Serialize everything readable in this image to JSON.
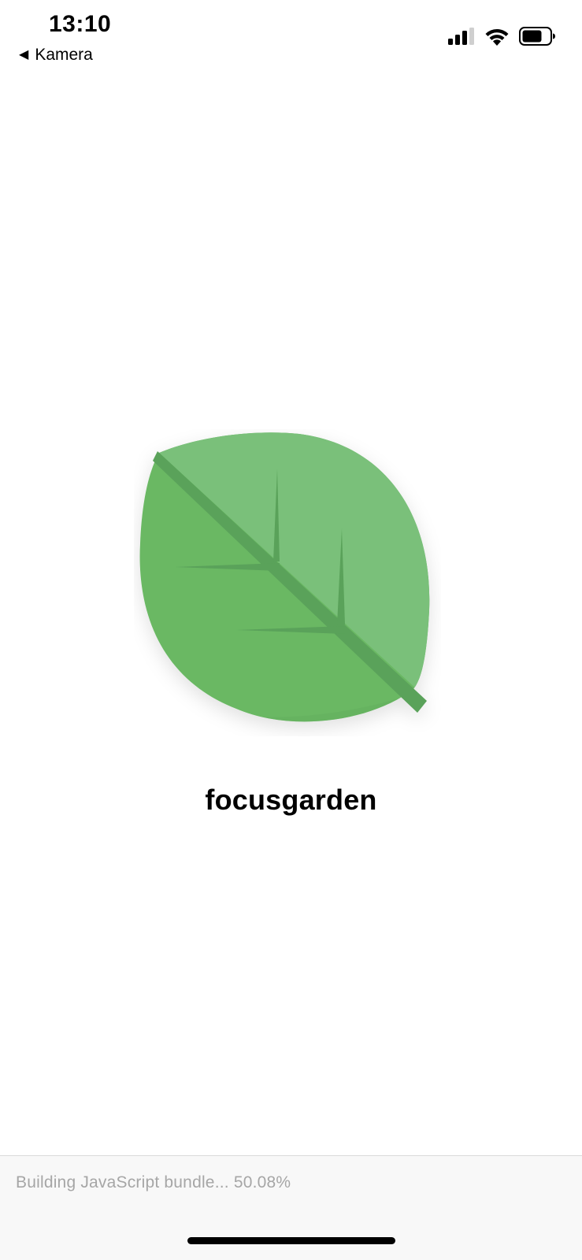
{
  "status_bar": {
    "time": "13:10",
    "back_label": "Kamera",
    "back_icon": "triangle-left-icon",
    "signal_icon": "cellular-signal-icon",
    "wifi_icon": "wifi-icon",
    "battery_icon": "battery-icon"
  },
  "splash": {
    "logo_icon": "leaf-icon",
    "app_name": "focusgarden",
    "colors": {
      "leaf_light": "#7ac07a",
      "leaf_dark": "#6ab864",
      "vein": "#5aa25a"
    }
  },
  "loading": {
    "text": "Building JavaScript bundle... 50.08%"
  }
}
